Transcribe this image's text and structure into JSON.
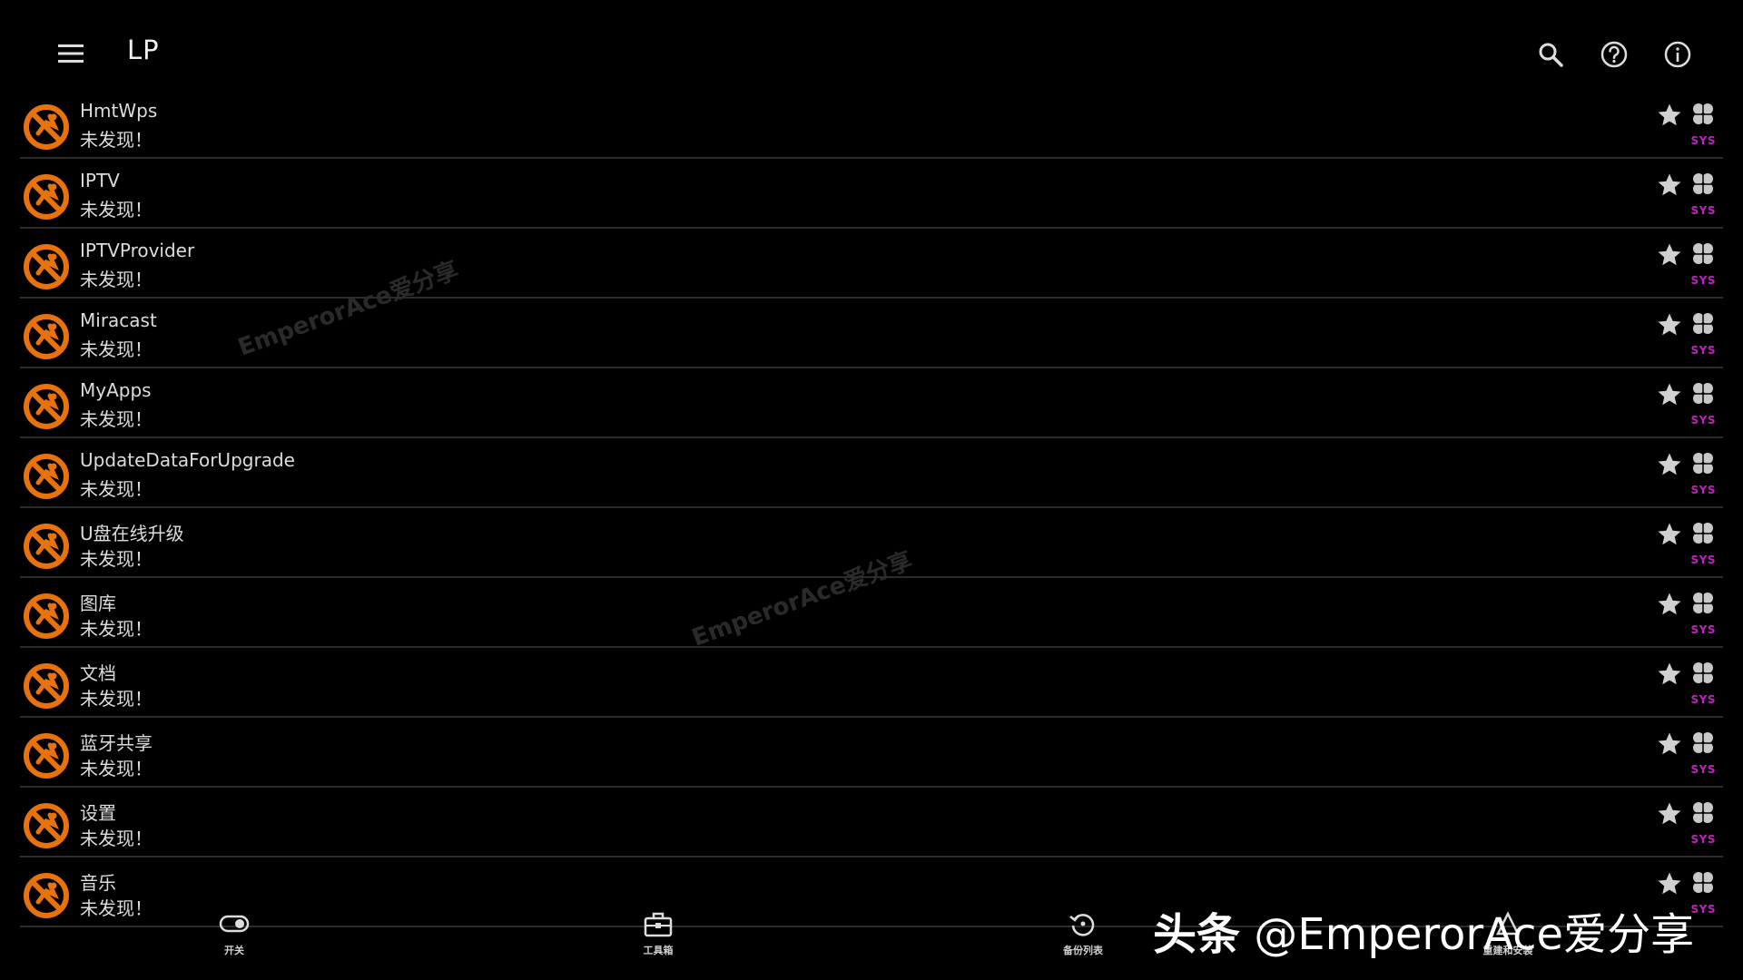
{
  "toolbar": {
    "title": "LP",
    "icons": [
      "menu-icon",
      "search-icon",
      "help-icon",
      "info-icon"
    ]
  },
  "list": {
    "status_text": "未发现！",
    "tag": "SYS",
    "items": [
      {
        "name": "HmtWps"
      },
      {
        "name": "IPTV"
      },
      {
        "name": "IPTVProvider"
      },
      {
        "name": "Miracast"
      },
      {
        "name": "MyApps"
      },
      {
        "name": "UpdateDataForUpgrade"
      },
      {
        "name": "U盘在线升级"
      },
      {
        "name": "图库"
      },
      {
        "name": "文档"
      },
      {
        "name": "蓝牙共享"
      },
      {
        "name": "设置"
      },
      {
        "name": "音乐"
      }
    ]
  },
  "bottom_nav": {
    "items": [
      {
        "label": "开关",
        "icon": "toggle-icon"
      },
      {
        "label": "工具箱",
        "icon": "toolbox-icon"
      },
      {
        "label": "备份列表",
        "icon": "restore-icon"
      },
      {
        "label": "重建和安装",
        "icon": "rebuild-icon"
      }
    ]
  },
  "watermarks": [
    "EmperorAce爱分享",
    "EmperorAce爱分享"
  ],
  "brand": {
    "prefix": "头条",
    "handle": "@EmperorAce爱分享"
  },
  "colors": {
    "background": "#000000",
    "icon_orange": "#e8720c",
    "sys_tag": "#c020c0",
    "divider": "#2c2c2c"
  }
}
